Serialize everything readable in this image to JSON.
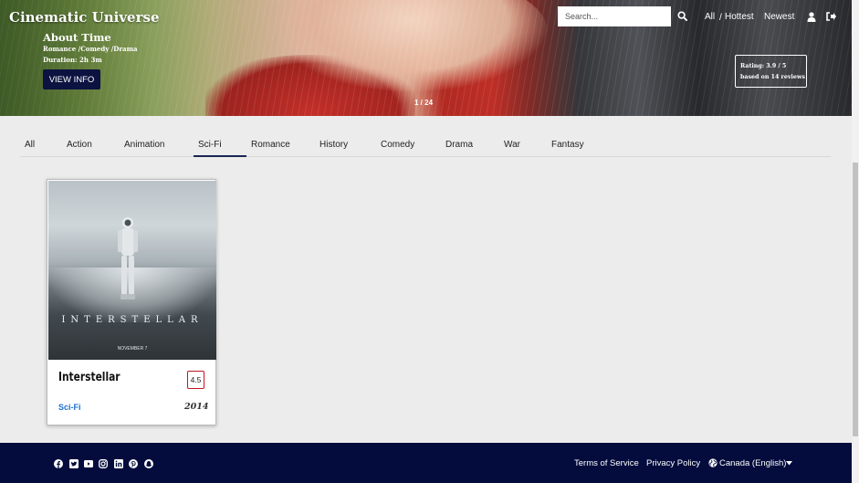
{
  "header": {
    "brand": "Cinematic Universe",
    "search": {
      "placeholder": "Search..."
    },
    "nav": [
      "All",
      "Hottest",
      "Newest"
    ],
    "separator": "/"
  },
  "hero": {
    "title": "About Time",
    "genres": "Romance /Comedy /Drama",
    "duration": "Duration: 2h 3m",
    "button_label": "VIEW INFO",
    "slide_counter": "1 / 24",
    "rating_line1": "Rating: 3.9 / 5",
    "rating_line2": "based on 14 reviews"
  },
  "tabs": {
    "items": [
      "All",
      "Action",
      "Animation",
      "Sci-Fi",
      "Romance",
      "History",
      "Comedy",
      "Drama",
      "War",
      "Fantasy"
    ],
    "active": "Sci-Fi"
  },
  "movies": [
    {
      "title": "Interstellar",
      "rating": "4.5",
      "genre": "Sci-Fi",
      "year": "2014",
      "poster_title": "INTERSTELLAR",
      "poster_date": "NOVEMBER 7"
    }
  ],
  "footer": {
    "social_icons": [
      "facebook-icon",
      "twitter-icon",
      "youtube-icon",
      "instagram-icon",
      "linkedin-icon",
      "pinterest-icon",
      "snapchat-icon"
    ],
    "links": [
      "Terms of Service",
      "Privacy Policy"
    ],
    "locale": "Canada (English)"
  },
  "colors": {
    "navy": "#030c3d",
    "button": "#0c1340",
    "link_blue": "#1c6fd1",
    "badge_red": "#c0161f"
  }
}
